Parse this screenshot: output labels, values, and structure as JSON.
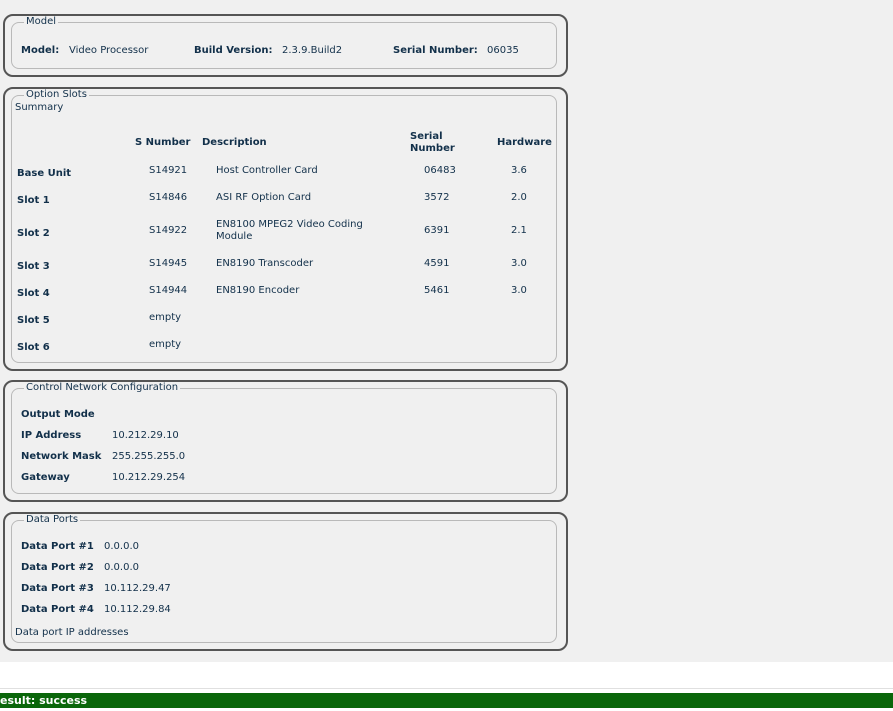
{
  "model": {
    "legend": "Model",
    "model_label": "Model:",
    "model_value": "Video Processor",
    "build_label": "Build Version:",
    "build_value": "2.3.9.Build2",
    "serial_label": "Serial Number:",
    "serial_value": "06035"
  },
  "option_slots": {
    "legend": "Option Slots",
    "summary": "Summary",
    "headers": {
      "s_number": "S Number",
      "description": "Description",
      "serial_number": "Serial Number",
      "hardware": "Hardware"
    },
    "rows": [
      {
        "slot": "Base Unit",
        "s_number": "S14921",
        "description": "Host Controller Card",
        "serial": "06483",
        "hardware": "3.6"
      },
      {
        "slot": "Slot 1",
        "s_number": "S14846",
        "description": "ASI RF Option Card",
        "serial": "3572",
        "hardware": "2.0"
      },
      {
        "slot": "Slot 2",
        "s_number": "S14922",
        "description": "EN8100 MPEG2 Video Coding Module",
        "serial": "6391",
        "hardware": "2.1"
      },
      {
        "slot": "Slot 3",
        "s_number": "S14945",
        "description": "EN8190 Transcoder",
        "serial": "4591",
        "hardware": "3.0"
      },
      {
        "slot": "Slot 4",
        "s_number": "S14944",
        "description": "EN8190 Encoder",
        "serial": "5461",
        "hardware": "3.0"
      },
      {
        "slot": "Slot 5",
        "s_number": "empty",
        "description": "",
        "serial": "",
        "hardware": ""
      },
      {
        "slot": "Slot 6",
        "s_number": "empty",
        "description": "",
        "serial": "",
        "hardware": ""
      }
    ]
  },
  "control_network": {
    "legend": "Control Network Configuration",
    "output_mode_label": "Output Mode",
    "ip_label": "IP Address",
    "ip_value": "10.212.29.10",
    "mask_label": "Network Mask",
    "mask_value": "255.255.255.0",
    "gateway_label": "Gateway",
    "gateway_value": "10.212.29.254"
  },
  "data_ports": {
    "legend": "Data Ports",
    "ports": [
      {
        "label": "Data Port #1",
        "value": "0.0.0.0"
      },
      {
        "label": "Data Port #2",
        "value": "0.0.0.0"
      },
      {
        "label": "Data Port #3",
        "value": "10.112.29.47"
      },
      {
        "label": "Data Port #4",
        "value": "10.112.29.84"
      }
    ],
    "note": "Data port IP addresses"
  },
  "result": {
    "text": "esult: success",
    "color": "#0a660a"
  }
}
